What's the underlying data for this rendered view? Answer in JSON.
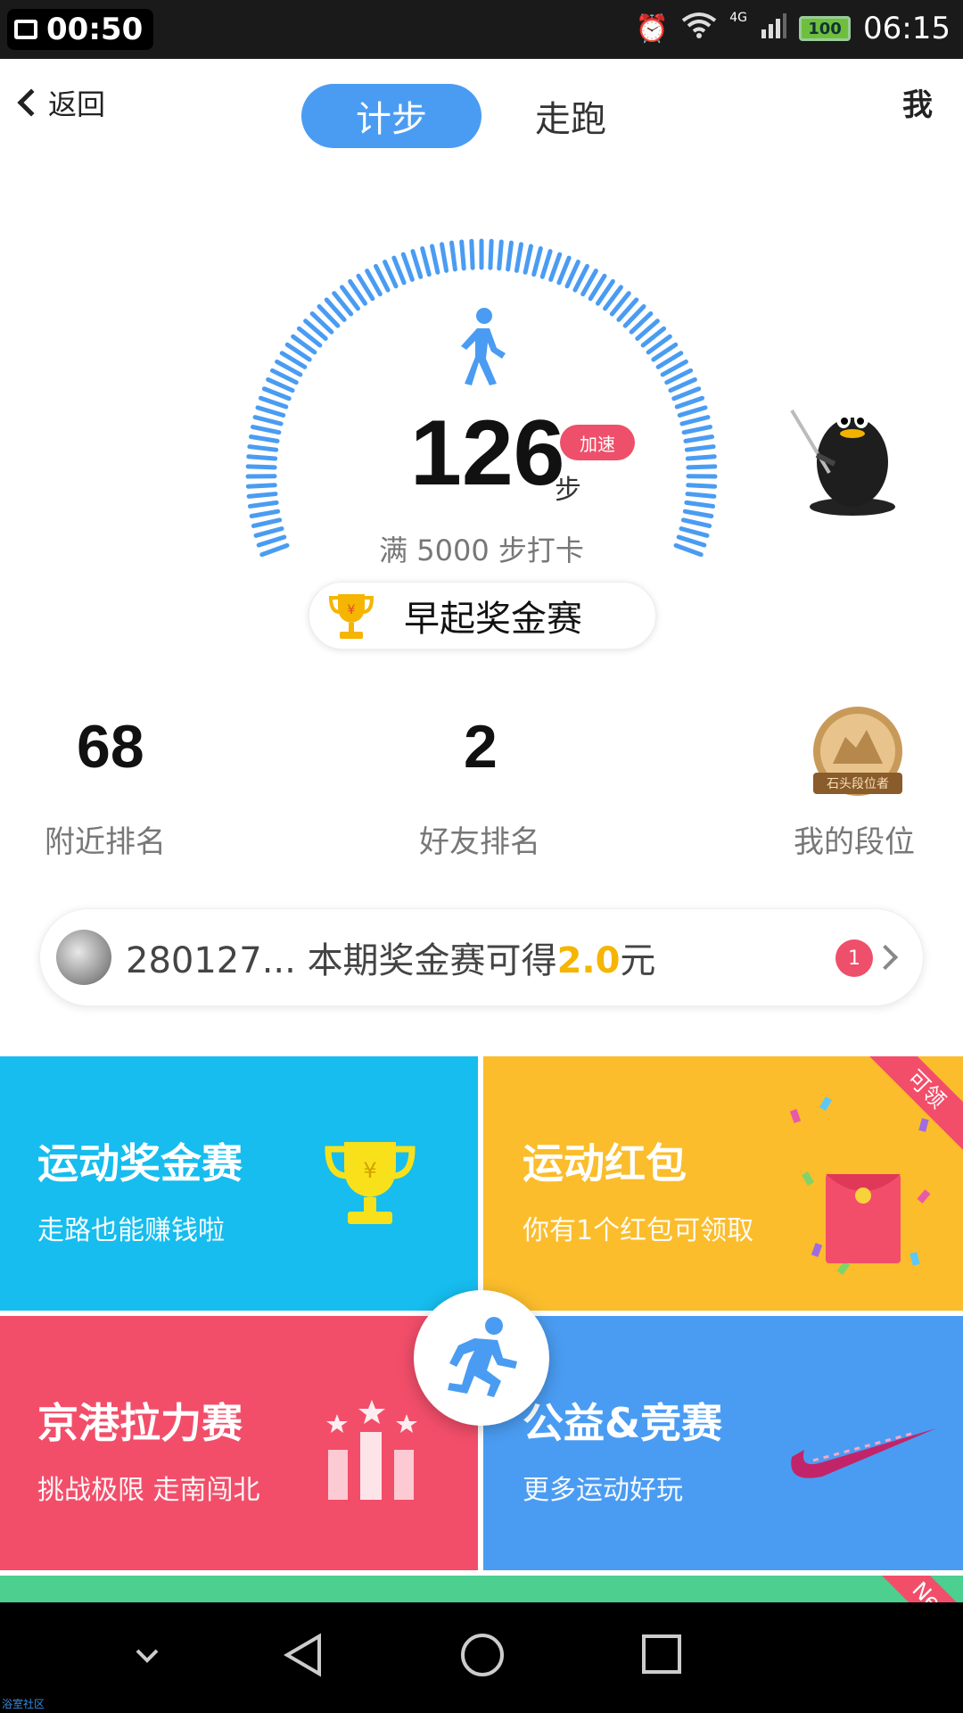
{
  "status_bar": {
    "recording_time": "00:50",
    "clock": "06:15",
    "battery": "100",
    "network": "4G"
  },
  "header": {
    "back_label": "返回",
    "tabs": [
      {
        "label": "计步",
        "active": true
      },
      {
        "label": "走跑",
        "active": false
      }
    ],
    "me_label": "我"
  },
  "pedometer": {
    "steps": "126",
    "unit": "步",
    "boost_label": "加速",
    "goal_text": "满 5000 步打卡",
    "progress_fraction": 0.025,
    "early_bird_label": "早起奖金赛"
  },
  "stats": {
    "nearby_rank": "68",
    "nearby_label": "附近排名",
    "friend_rank": "2",
    "friend_label": "好友排名",
    "level_label": "我的段位",
    "level_badge_text": "石头段位者"
  },
  "prize": {
    "user": "280127...",
    "text_prefix": "本期奖金赛可得",
    "amount": "2.0",
    "text_suffix": "元",
    "notification_count": "1"
  },
  "tiles": [
    {
      "title": "运动奖金赛",
      "subtitle": "走路也能赚钱啦",
      "color": "#16bdee"
    },
    {
      "title": "运动红包",
      "subtitle": "你有1个红包可领取",
      "ribbon": "可领",
      "color": "#fbbd2c"
    },
    {
      "title": "京港拉力赛",
      "subtitle": "挑战极限 走南闯北",
      "color": "#f24e6a"
    },
    {
      "title": "公益&竞赛",
      "subtitle": "更多运动好玩",
      "color": "#4a9cf2"
    }
  ],
  "partial_tile": {
    "ribbon": "Ne",
    "color": "#4ccf8f"
  },
  "colors": {
    "accent_blue": "#4a9cf2",
    "accent_pink": "#ee4f6a",
    "accent_gold": "#f5b500"
  },
  "footer_credit": "浴室社区"
}
